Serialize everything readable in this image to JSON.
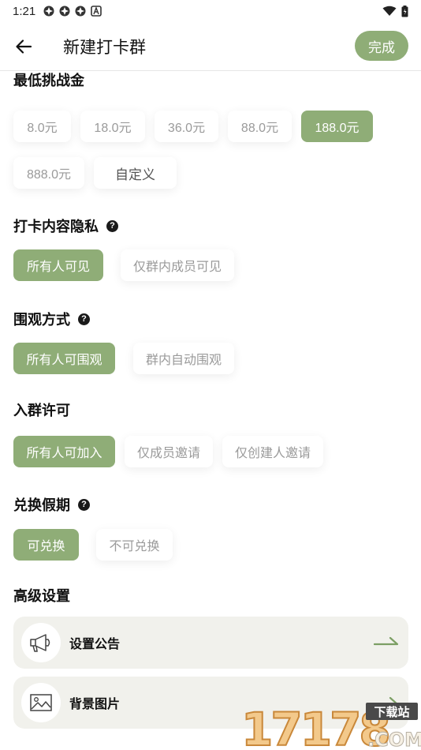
{
  "status_bar": {
    "time": "1:21"
  },
  "app_bar": {
    "title": "新建打卡群",
    "done_label": "完成"
  },
  "min_challenge": {
    "title": "最低挑战金",
    "options": [
      "8.0元",
      "18.0元",
      "36.0元",
      "88.0元",
      "188.0元",
      "888.0元"
    ],
    "custom_label": "自定义",
    "selected": "188.0元"
  },
  "privacy": {
    "title": "打卡内容隐私",
    "options": [
      "所有人可见",
      "仅群内成员可见"
    ],
    "selected": "所有人可见"
  },
  "spectate": {
    "title": "围观方式",
    "options": [
      "所有人可围观",
      "群内自动围观"
    ],
    "selected": "所有人可围观"
  },
  "join": {
    "title": "入群许可",
    "options": [
      "所有人可加入",
      "仅成员邀请",
      "仅创建人邀请"
    ],
    "selected": "所有人可加入"
  },
  "holiday": {
    "title": "兑换假期",
    "options": [
      "可兑换",
      "不可兑换"
    ],
    "selected": "可兑换"
  },
  "advanced": {
    "title": "高级设置",
    "items": [
      {
        "label": "设置公告",
        "icon": "megaphone-icon"
      },
      {
        "label": "背景图片",
        "icon": "image-icon"
      }
    ]
  },
  "watermark": {
    "logo_text": "17178",
    "tag": "下载站",
    "suffix": ".COM"
  },
  "colors": {
    "accent": "#8fad77",
    "row_bg": "#f1f1ec"
  }
}
